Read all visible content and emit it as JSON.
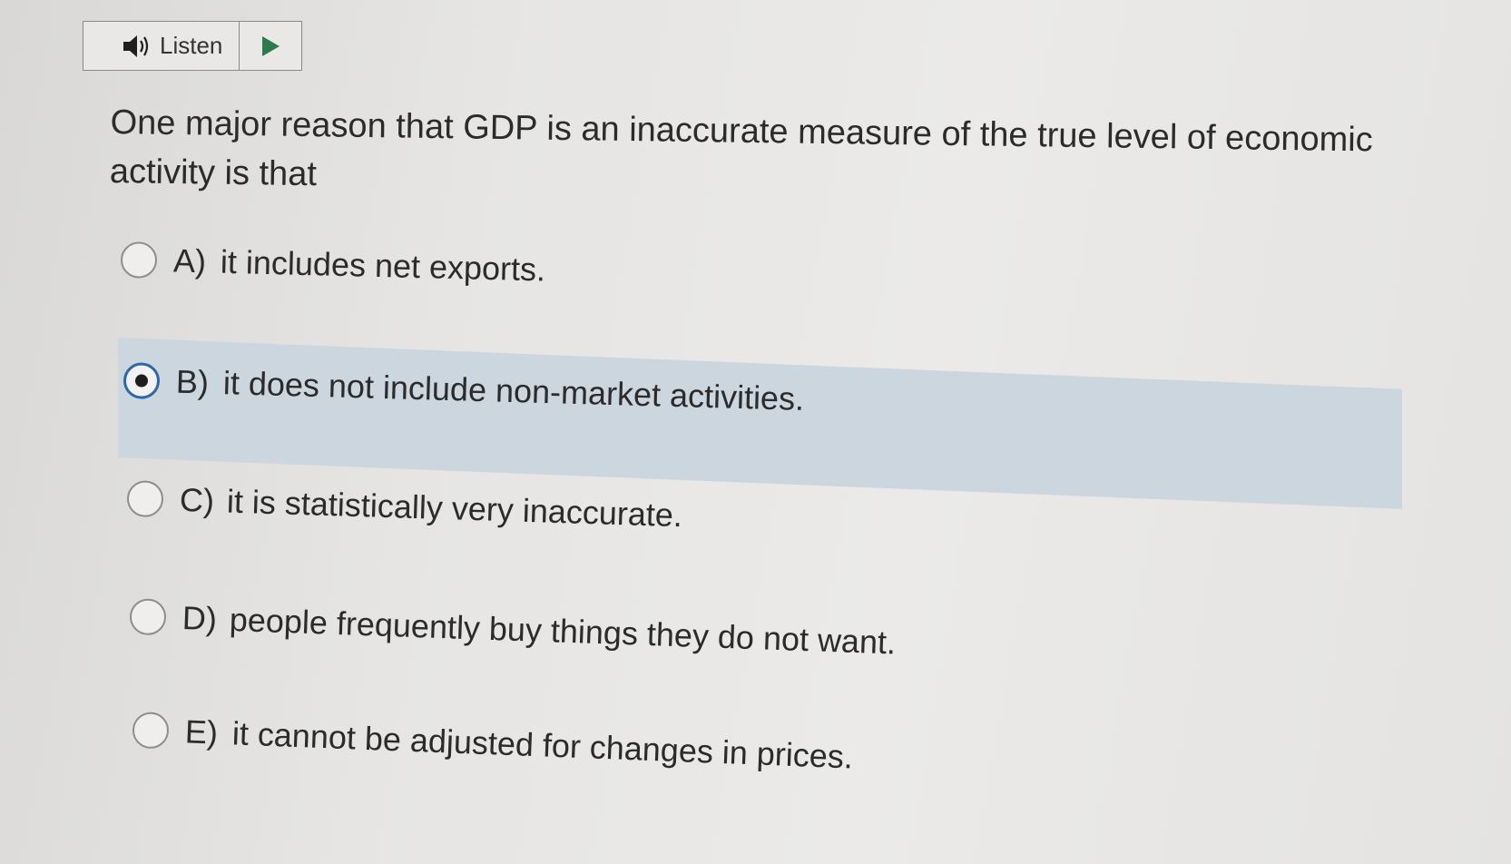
{
  "listen": {
    "label": "Listen",
    "speaker_icon": "speaker-icon",
    "play_icon": "play-icon"
  },
  "question": {
    "text": "One major reason that GDP is an inaccurate measure of the true level of economic activity is that"
  },
  "options": [
    {
      "letter": "A)",
      "text": "it includes net exports.",
      "selected": false
    },
    {
      "letter": "B)",
      "text": "it does not include non-market activities.",
      "selected": true
    },
    {
      "letter": "C)",
      "text": "it is statistically very inaccurate.",
      "selected": false
    },
    {
      "letter": "D)",
      "text": "people frequently buy things they do not want.",
      "selected": false
    },
    {
      "letter": "E)",
      "text": "it cannot be adjusted for changes in prices.",
      "selected": false
    }
  ],
  "colors": {
    "selected_highlight": "#cbd6df",
    "selected_radio_ring": "#2e67a8",
    "play_triangle": "#2f7a4a"
  }
}
